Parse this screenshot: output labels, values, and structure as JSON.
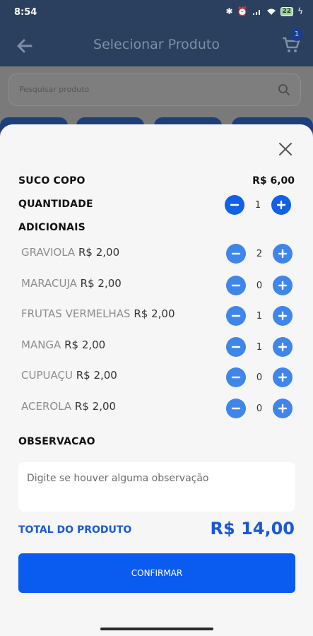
{
  "status_bar": {
    "time": "8:54",
    "battery": "22"
  },
  "header": {
    "title": "Selecionar Produto",
    "cart_count": "1"
  },
  "search": {
    "placeholder": "Pesquisar produto"
  },
  "product": {
    "name": "SUCO COPO",
    "price": "R$ 6,00"
  },
  "quantity": {
    "label": "QUANTIDADE",
    "value": "1"
  },
  "addons": {
    "title": "ADICIONAIS",
    "items": [
      {
        "name": "GRAVIOLA",
        "price": "R$ 2,00",
        "qty": "2"
      },
      {
        "name": "MARACUJA",
        "price": "R$ 2,00",
        "qty": "0"
      },
      {
        "name": "FRUTAS VERMELHAS",
        "price": "R$ 2,00",
        "qty": "1"
      },
      {
        "name": "MANGA",
        "price": "R$ 2,00",
        "qty": "1"
      },
      {
        "name": "CUPUAÇU",
        "price": "R$ 2,00",
        "qty": "0"
      },
      {
        "name": "ACEROLA",
        "price": "R$ 2,00",
        "qty": "0"
      }
    ]
  },
  "observation": {
    "label": "OBSERVACAO",
    "placeholder": "Digite se houver alguma observação"
  },
  "total": {
    "label": "TOTAL DO PRODUTO",
    "value": "R$ 14,00"
  },
  "confirm": {
    "label": "CONFIRMAR"
  },
  "colors": {
    "primary": "#0a5bf0",
    "stepper_light": "#3f86ea",
    "header_bg": "#2a405e"
  }
}
